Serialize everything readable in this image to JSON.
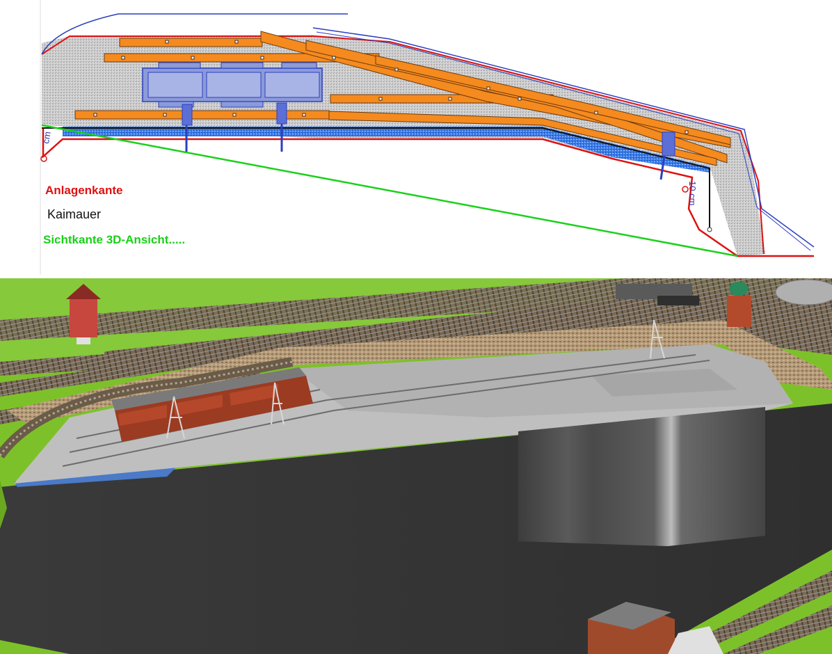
{
  "legend": {
    "edge": "Anlagenkante",
    "quay_wall": "Kaimauer",
    "view_edge": "Sichtkante 3D-Ansicht....."
  },
  "measurements": {
    "left": "cm",
    "right": "10 cm"
  },
  "colors": {
    "edge": "#dd1111",
    "quay_wall": "#111111",
    "view_edge": "#19d019",
    "track": "#f58a1e",
    "water": "#2a6ee0",
    "pier": "#c8c8c8",
    "terrain": "#7dc12a",
    "void": "#3c3c3c"
  }
}
